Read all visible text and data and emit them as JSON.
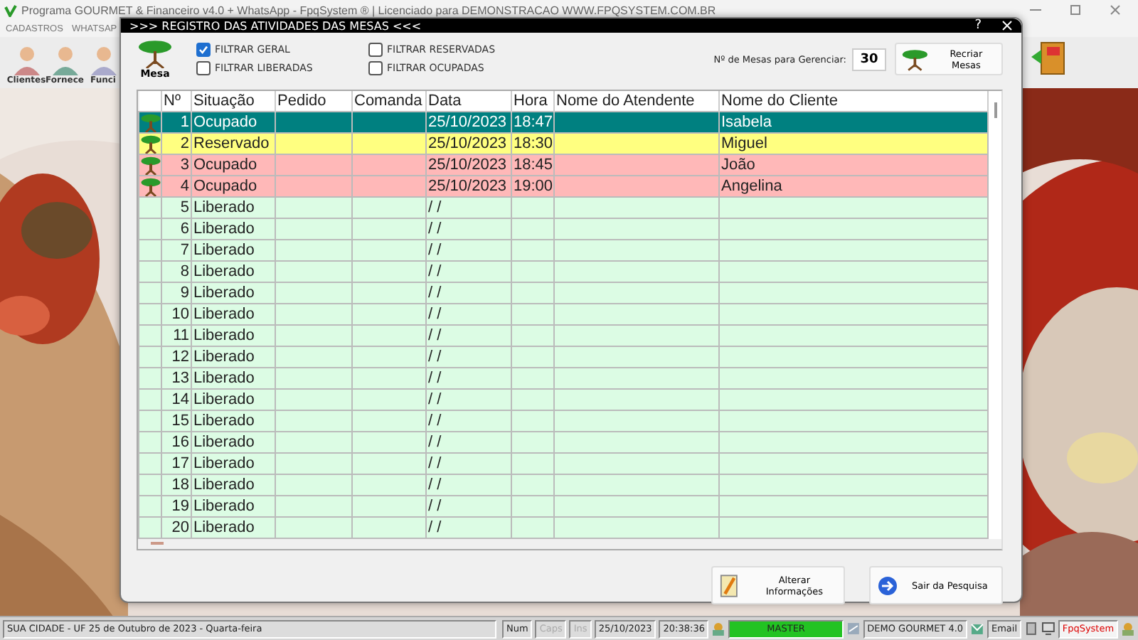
{
  "app": {
    "title": "Programa GOURMET & Financeiro v4.0 + WhatsApp - FpqSystem ® | Licenciado para  DEMONSTRACAO WWW.FPQSYSTEM.COM.BR"
  },
  "menu": [
    "CADASTROS",
    "WHATSAP"
  ],
  "toolbar": [
    {
      "label": "Clientes"
    },
    {
      "label": "Fornece"
    },
    {
      "label": "Funci"
    }
  ],
  "dialog": {
    "title": ">>> REGISTRO DAS ATIVIDADES DAS MESAS <<<",
    "help": "?",
    "mesa_label": "Mesa",
    "filters": [
      {
        "label": "FILTRAR GERAL",
        "checked": true
      },
      {
        "label": "FILTRAR LIBERADAS",
        "checked": false
      },
      {
        "label": "FILTRAR RESERVADAS",
        "checked": false
      },
      {
        "label": "FILTRAR OCUPADAS",
        "checked": false
      }
    ],
    "count_label": "Nº de Mesas para Gerenciar:",
    "count": "30",
    "recreate_button": "Recriar Mesas",
    "table": {
      "columns": [
        "Nº",
        "Situação",
        "Pedido",
        "Comanda",
        "Data",
        "Hora",
        "Nome do Atendente",
        "Nome do Cliente"
      ],
      "rows": [
        {
          "n": "1",
          "kind": "ocupado",
          "selected": true,
          "situacao": "Ocupado",
          "data": "25/10/2023",
          "hora": "18:47",
          "cliente": "Isabela"
        },
        {
          "n": "2",
          "kind": "reservado",
          "selected": false,
          "situacao": "Reservado",
          "data": "25/10/2023",
          "hora": "18:30",
          "cliente": "Miguel"
        },
        {
          "n": "3",
          "kind": "ocupado",
          "selected": false,
          "situacao": "Ocupado",
          "data": "25/10/2023",
          "hora": "18:45",
          "cliente": "João"
        },
        {
          "n": "4",
          "kind": "ocupado",
          "selected": false,
          "situacao": "Ocupado",
          "data": "25/10/2023",
          "hora": "19:00",
          "cliente": "Angelina"
        },
        {
          "n": "5",
          "kind": "liberado",
          "selected": false,
          "situacao": "Liberado",
          "data": "/ /"
        },
        {
          "n": "6",
          "kind": "liberado",
          "selected": false,
          "situacao": "Liberado",
          "data": "/ /"
        },
        {
          "n": "7",
          "kind": "liberado",
          "selected": false,
          "situacao": "Liberado",
          "data": "/ /"
        },
        {
          "n": "8",
          "kind": "liberado",
          "selected": false,
          "situacao": "Liberado",
          "data": "/ /"
        },
        {
          "n": "9",
          "kind": "liberado",
          "selected": false,
          "situacao": "Liberado",
          "data": "/ /"
        },
        {
          "n": "10",
          "kind": "liberado",
          "selected": false,
          "situacao": "Liberado",
          "data": "/ /"
        },
        {
          "n": "11",
          "kind": "liberado",
          "selected": false,
          "situacao": "Liberado",
          "data": "/ /"
        },
        {
          "n": "12",
          "kind": "liberado",
          "selected": false,
          "situacao": "Liberado",
          "data": "/ /"
        },
        {
          "n": "13",
          "kind": "liberado",
          "selected": false,
          "situacao": "Liberado",
          "data": "/ /"
        },
        {
          "n": "14",
          "kind": "liberado",
          "selected": false,
          "situacao": "Liberado",
          "data": "/ /"
        },
        {
          "n": "15",
          "kind": "liberado",
          "selected": false,
          "situacao": "Liberado",
          "data": "/ /"
        },
        {
          "n": "16",
          "kind": "liberado",
          "selected": false,
          "situacao": "Liberado",
          "data": "/ /"
        },
        {
          "n": "17",
          "kind": "liberado",
          "selected": false,
          "situacao": "Liberado",
          "data": "/ /"
        },
        {
          "n": "18",
          "kind": "liberado",
          "selected": false,
          "situacao": "Liberado",
          "data": "/ /"
        },
        {
          "n": "19",
          "kind": "liberado",
          "selected": false,
          "situacao": "Liberado",
          "data": "/ /"
        },
        {
          "n": "20",
          "kind": "liberado",
          "selected": false,
          "situacao": "Liberado",
          "data": "/ /"
        }
      ]
    },
    "buttons": [
      {
        "kind": "edit",
        "label": "Alterar Informações"
      },
      {
        "kind": "exit",
        "label": "Sair da Pesquisa"
      }
    ]
  },
  "status_bar": {
    "location": "SUA CIDADE - UF 25 de Outubro de 2023 - Quarta-feira",
    "panels": [
      {
        "text": "Num",
        "disabled": false
      },
      {
        "text": "Caps",
        "disabled": true
      },
      {
        "text": "Ins",
        "disabled": true
      },
      {
        "text": "25/10/2023",
        "disabled": false
      },
      {
        "text": "20:38:36",
        "disabled": false
      }
    ],
    "user": "MASTER",
    "company": "DEMO GOURMET 4.0",
    "email": "Email",
    "brand": "FpqSystem"
  }
}
